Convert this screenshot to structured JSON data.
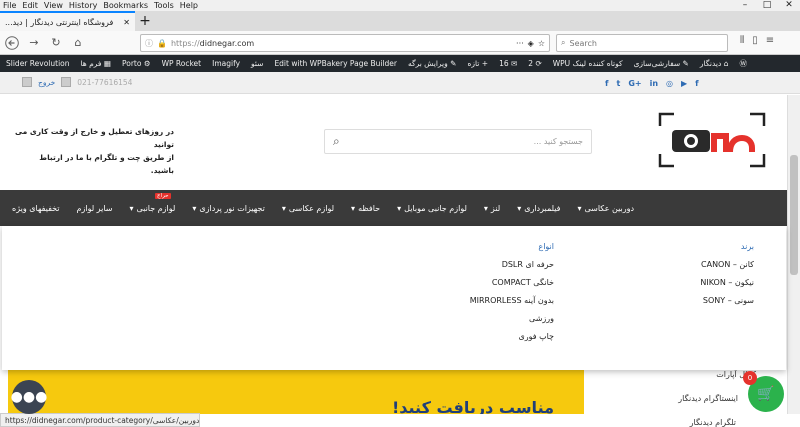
{
  "browser": {
    "menu": [
      "File",
      "Edit",
      "View",
      "History",
      "Bookmarks",
      "Tools",
      "Help"
    ],
    "tab_title": "فروشگاه اینترنتی دیدنگار | دید...",
    "url_prefix": "https://",
    "url": "didnegar.com",
    "search_placeholder": "Search",
    "status_url": "https://didnegar.com/product-category/دوربین/عکاسی/"
  },
  "adminbar": {
    "items": [
      "دیدنگار",
      "سفارشی‌سازی",
      "کوتاه کننده لینک WPU",
      "2",
      "16",
      "تازه",
      "ویرایش برگه",
      "Edit with WPBakery Page Builder",
      "سئو",
      "Imagify",
      "WP Rocket",
      "Porto",
      "فرم ها",
      "Slider Revolution"
    ]
  },
  "topbar": {
    "social": [
      "f",
      "t",
      "G+",
      "in",
      "◎",
      "▶",
      "f"
    ],
    "logout": "خروج",
    "phone": "021-77616154"
  },
  "header": {
    "search_placeholder": "جستجو کنید ...",
    "slogan_line1": "در روزهای تعطیل و خارج از وقت کاری می توانید",
    "slogan_line2": "از طریق چت و تلگرام با ما در ارتباط باشید."
  },
  "nav": {
    "items": [
      {
        "label": "دوربین عکاسی",
        "arrow": true
      },
      {
        "label": "فیلمبرداری",
        "arrow": true
      },
      {
        "label": "لنز",
        "arrow": true
      },
      {
        "label": "لوازم جانبی موبایل",
        "arrow": true
      },
      {
        "label": "حافظه",
        "arrow": true
      },
      {
        "label": "لوازم عکاسی",
        "arrow": true
      },
      {
        "label": "تجهیزات نور پردازی",
        "arrow": true
      },
      {
        "label": "لوازم جانبی",
        "arrow": true
      },
      {
        "label": "سایر لوازم",
        "arrow": false
      },
      {
        "label": "تخفیفهای ویژه",
        "arrow": false
      }
    ],
    "sale_badge": "حراج"
  },
  "megamenu": {
    "brand_heading": "برند",
    "brands": [
      "کانن – CANON",
      "نیکون – NIKON",
      "سونی – SONY"
    ],
    "type_heading": "انواع",
    "types": [
      "حرفه ای DSLR",
      "خانگی COMPACT",
      "بدون آینه MIRRORLESS",
      "ورزشی",
      "چاپ فوری"
    ]
  },
  "content": {
    "banner_text": "مناسب دریافت کنید!",
    "sidebar_items": [
      "کانال آپارات",
      "اینستاگرام دیدنگار",
      "تلگرام دیدنگار"
    ]
  },
  "cart": {
    "count": "0"
  }
}
